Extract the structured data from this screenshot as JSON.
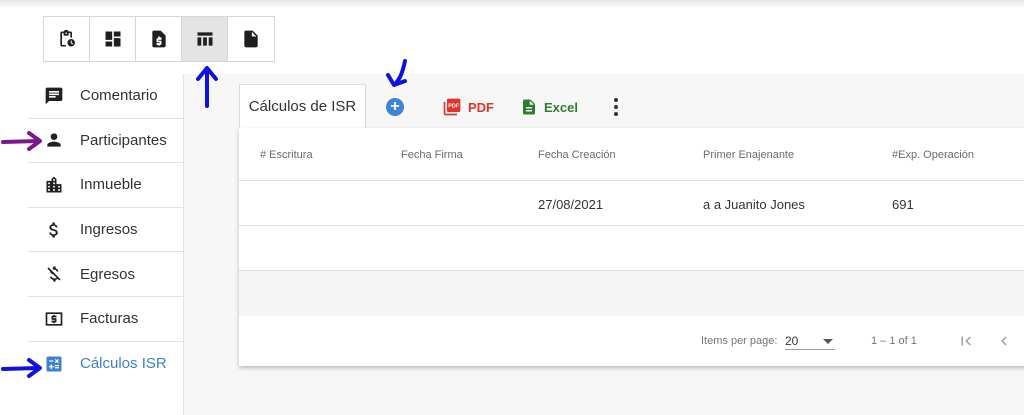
{
  "toolbar": {
    "buttons": [
      {
        "icon": "clipboard-clock-icon",
        "active": false
      },
      {
        "icon": "dashboard-icon",
        "active": false
      },
      {
        "icon": "dollar-document-icon",
        "active": false
      },
      {
        "icon": "table-view-icon",
        "active": true
      },
      {
        "icon": "document-icon",
        "active": false
      }
    ]
  },
  "menu": {
    "items": [
      {
        "label": "Comentario",
        "icon": "comment-icon"
      },
      {
        "label": "Participantes",
        "icon": "person-icon"
      },
      {
        "label": "Inmueble",
        "icon": "building-icon"
      },
      {
        "label": "Ingresos",
        "icon": "dollar-icon"
      },
      {
        "label": "Egresos",
        "icon": "money-off-icon"
      },
      {
        "label": "Facturas",
        "icon": "bill-icon"
      },
      {
        "label": "Cálculos ISR",
        "icon": "calculate-icon",
        "active": true
      }
    ]
  },
  "tab": {
    "label": "Cálculos de ISR"
  },
  "actions": {
    "pdf_label": "PDF",
    "excel_label": "Excel"
  },
  "table": {
    "headers": [
      "# Escritura",
      "Fecha Firma",
      "Fecha Creación",
      "Primer Enajenante",
      "#Exp. Operación"
    ],
    "rows": [
      [
        "",
        "",
        "27/08/2021",
        "a a Juanito Jones",
        "691"
      ]
    ]
  },
  "paginator": {
    "items_per_page_label": "Items per page:",
    "page_size": "20",
    "range_label": "1 – 1 of 1"
  },
  "colors": {
    "accent": "#3d7fd6",
    "annotation_blue": "#1010e0",
    "annotation_purple": "#7a1a8a",
    "pdf_red": "#e0342b",
    "excel_green": "#2e7d32"
  }
}
